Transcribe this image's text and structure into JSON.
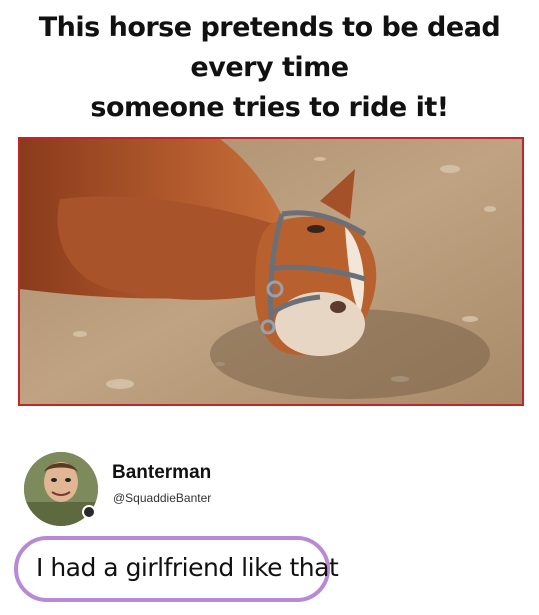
{
  "meme": {
    "headline_line1": "This horse pretends to be dead every time",
    "headline_line2": "someone tries to ride it!"
  },
  "photo": {
    "subject": "horse lying on dirt ground",
    "frame_color": "#c1262b"
  },
  "tweet": {
    "display_name": "Banterman",
    "handle": "@SquaddieBanter",
    "reply": "I had a girlfriend like that",
    "highlight_color": "#b88ad6"
  }
}
